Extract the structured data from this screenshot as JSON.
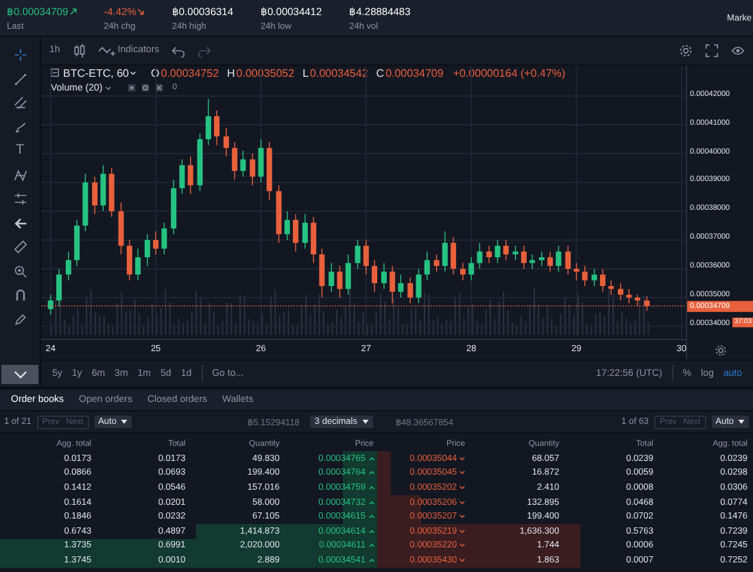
{
  "ticker": [
    {
      "value": "฿0.00034709",
      "label": "Last",
      "kind": "rise"
    },
    {
      "value": "-4.42%",
      "label": "24h chg",
      "kind": "fall"
    },
    {
      "value": "฿0.00036314",
      "label": "24h high",
      "kind": "plain"
    },
    {
      "value": "฿0.00034412",
      "label": "24h low",
      "kind": "plain"
    },
    {
      "value": "฿4.28884483",
      "label": "24h vol",
      "kind": "plain"
    }
  ],
  "market_tab": "Marke",
  "toolbar": {
    "interval": "1h",
    "indicators": "Indicators"
  },
  "text_tool": "T",
  "legend": {
    "symbol": "BTC-ETC, 60",
    "open_label": "O",
    "open": "0.00034752",
    "high_label": "H",
    "high": "0.00035052",
    "low_label": "L",
    "low": "0.00034542",
    "close_label": "C",
    "close": "0.00034709",
    "change": "+0.00000164 (+0.47%)"
  },
  "volume": {
    "label": "Volume (20)",
    "value": "0"
  },
  "chart_data": {
    "type": "candlestick",
    "x": [
      24,
      24.08,
      24.17,
      24.25,
      24.33,
      24.42,
      24.5,
      24.58,
      24.67,
      24.75,
      24.83,
      24.92,
      25,
      25.08,
      25.17,
      25.25,
      25.33,
      25.42,
      25.5,
      25.58,
      25.67,
      25.75,
      25.83,
      25.92,
      26,
      26.08,
      26.17,
      26.25,
      26.33,
      26.42,
      26.5,
      26.58,
      26.67,
      26.75,
      26.83,
      26.92,
      27,
      27.08,
      27.17,
      27.25,
      27.33,
      27.42,
      27.5,
      27.58,
      27.67,
      27.75,
      27.83,
      27.92,
      28,
      28.08,
      28.17,
      28.25,
      28.33,
      28.42,
      28.5,
      28.58,
      28.67,
      28.75,
      28.83,
      28.92,
      29,
      29.08,
      29.17,
      29.25,
      29.33,
      29.42,
      29.5,
      29.58,
      29.67
    ],
    "ohlc": [
      [
        0.000346,
        0.000351,
        0.000344,
        0.000349
      ],
      [
        0.000349,
        0.00036,
        0.000347,
        0.000358
      ],
      [
        0.000358,
        0.000366,
        0.000356,
        0.000363
      ],
      [
        0.000363,
        0.000377,
        0.000361,
        0.000375
      ],
      [
        0.000375,
        0.000393,
        0.000373,
        0.00039
      ],
      [
        0.00039,
        0.000392,
        0.000379,
        0.000382
      ],
      [
        0.000382,
        0.000396,
        0.00038,
        0.000393
      ],
      [
        0.000393,
        0.000395,
        0.000378,
        0.00038
      ],
      [
        0.00038,
        0.000383,
        0.000365,
        0.000368
      ],
      [
        0.000368,
        0.00037,
        0.000356,
        0.000358
      ],
      [
        0.000358,
        0.000367,
        0.000356,
        0.000364
      ],
      [
        0.000364,
        0.000372,
        0.000361,
        0.00037
      ],
      [
        0.00037,
        0.000373,
        0.000365,
        0.000367
      ],
      [
        0.000367,
        0.000376,
        0.000365,
        0.000374
      ],
      [
        0.000374,
        0.000391,
        0.000372,
        0.000388
      ],
      [
        0.000388,
        0.000398,
        0.000386,
        0.000396
      ],
      [
        0.000396,
        0.000399,
        0.000386,
        0.000389
      ],
      [
        0.000389,
        0.000407,
        0.000387,
        0.000405
      ],
      [
        0.000405,
        0.000419,
        0.000403,
        0.000413
      ],
      [
        0.000413,
        0.000415,
        0.000403,
        0.000406
      ],
      [
        0.000406,
        0.000409,
        0.000399,
        0.000402
      ],
      [
        0.000402,
        0.000404,
        0.000391,
        0.000394
      ],
      [
        0.000394,
        0.000401,
        0.000392,
        0.000398
      ],
      [
        0.000398,
        0.0004,
        0.000389,
        0.000392
      ],
      [
        0.000392,
        0.000405,
        0.00039,
        0.000402
      ],
      [
        0.000402,
        0.000404,
        0.000384,
        0.000387
      ],
      [
        0.000387,
        0.000389,
        0.000369,
        0.000372
      ],
      [
        0.000372,
        0.00038,
        0.00037,
        0.000377
      ],
      [
        0.000377,
        0.000379,
        0.000366,
        0.000369
      ],
      [
        0.000369,
        0.000379,
        0.000367,
        0.000376
      ],
      [
        0.000376,
        0.000378,
        0.000362,
        0.000365
      ],
      [
        0.000365,
        0.000367,
        0.00035,
        0.000354
      ],
      [
        0.000354,
        0.000362,
        0.000352,
        0.000359
      ],
      [
        0.000359,
        0.000361,
        0.00035,
        0.000353
      ],
      [
        0.000353,
        0.000365,
        0.000351,
        0.000362
      ],
      [
        0.000362,
        0.00037,
        0.00036,
        0.000368
      ],
      [
        0.000368,
        0.00037,
        0.000358,
        0.000361
      ],
      [
        0.000361,
        0.000363,
        0.000352,
        0.000355
      ],
      [
        0.000355,
        0.000362,
        0.000353,
        0.000359
      ],
      [
        0.000359,
        0.000361,
        0.000348,
        0.000352
      ],
      [
        0.000352,
        0.000358,
        0.00035,
        0.000355
      ],
      [
        0.000355,
        0.000357,
        0.000348,
        0.00035
      ],
      [
        0.00035,
        0.00036,
        0.000348,
        0.000358
      ],
      [
        0.000358,
        0.000366,
        0.000356,
        0.000363
      ],
      [
        0.000363,
        0.000365,
        0.000359,
        0.000361
      ],
      [
        0.000361,
        0.000373,
        0.000359,
        0.000369
      ],
      [
        0.000369,
        0.000371,
        0.000358,
        0.00036
      ],
      [
        0.00036,
        0.000362,
        0.000356,
        0.000358
      ],
      [
        0.000358,
        0.000364,
        0.000356,
        0.000362
      ],
      [
        0.000362,
        0.000369,
        0.00036,
        0.000366
      ],
      [
        0.000366,
        0.000368,
        0.000362,
        0.000364
      ],
      [
        0.000364,
        0.00037,
        0.000362,
        0.000368
      ],
      [
        0.000368,
        0.00037,
        0.000363,
        0.000365
      ],
      [
        0.000365,
        0.000368,
        0.000363,
        0.000366
      ],
      [
        0.000366,
        0.000368,
        0.00036,
        0.000362
      ],
      [
        0.000362,
        0.000365,
        0.00036,
        0.000363
      ],
      [
        0.000363,
        0.000366,
        0.000361,
        0.000364
      ],
      [
        0.000364,
        0.000366,
        0.000359,
        0.000361
      ],
      [
        0.000361,
        0.000368,
        0.000359,
        0.000366
      ],
      [
        0.000366,
        0.000368,
        0.000358,
        0.00036
      ],
      [
        0.00036,
        0.000362,
        0.000356,
        0.000359
      ],
      [
        0.000359,
        0.000361,
        0.000354,
        0.000356
      ],
      [
        0.000356,
        0.00036,
        0.000354,
        0.000358
      ],
      [
        0.000358,
        0.00036,
        0.000352,
        0.000354
      ],
      [
        0.000354,
        0.000356,
        0.000351,
        0.000353
      ],
      [
        0.000353,
        0.000355,
        0.000349,
        0.000351
      ],
      [
        0.000351,
        0.000353,
        0.000348,
        0.00035
      ],
      [
        0.00035,
        0.000351,
        0.000347,
        0.000349
      ],
      [
        0.000349,
        0.0003505,
        0.0003454,
        0.0003471
      ]
    ],
    "yticks": [
      {
        "value": 0.00042,
        "label": "0.00042000"
      },
      {
        "value": 0.00041,
        "label": "0.00041000"
      },
      {
        "value": 0.0004,
        "label": "0.00040000"
      },
      {
        "value": 0.00039,
        "label": "0.00039000"
      },
      {
        "value": 0.00038,
        "label": "0.00038000"
      },
      {
        "value": 0.00037,
        "label": "0.00037000"
      },
      {
        "value": 0.00036,
        "label": "0.00036000"
      },
      {
        "value": 0.00035,
        "label": "0.00035000"
      },
      {
        "value": 0.00034,
        "label": "0.00034000"
      }
    ],
    "xticks": [
      24,
      25,
      26,
      27,
      28,
      29,
      30
    ],
    "xlim": [
      23.91,
      30.04
    ],
    "ylim": [
      0.0003352,
      0.0004305
    ],
    "grid": true,
    "ref_lines": [
      {
        "axis": "y",
        "value": 0.00034709
      }
    ]
  },
  "last_price": "0.00034709",
  "countdown": "37:03",
  "ranges": [
    "5y",
    "1y",
    "6m",
    "3m",
    "1m",
    "5d",
    "1d"
  ],
  "goto": "Go to...",
  "clock": "17:22:56 (UTC)",
  "scale_options": [
    {
      "label": "%",
      "selected": false
    },
    {
      "label": "log",
      "selected": false
    },
    {
      "label": "auto",
      "selected": true
    }
  ],
  "tabs": [
    {
      "label": "Order books",
      "selected": true
    },
    {
      "label": "Open orders",
      "selected": false
    },
    {
      "label": "Closed orders",
      "selected": false
    },
    {
      "label": "Wallets",
      "selected": false
    }
  ],
  "center": {
    "bid_sum": "฿5.15294118",
    "decimals": "3 decimals",
    "ask_sum": "฿48.36567854"
  },
  "bids": {
    "page": "1 of 21",
    "prev": "Prev",
    "next": "Next",
    "grouping": "Auto",
    "columns": [
      "Agg. total",
      "Total",
      "Quantity",
      "Price"
    ],
    "rows": [
      {
        "agg": "0.0173",
        "total": "0.0173",
        "quantity": "49.830",
        "price": "0.00034765"
      },
      {
        "agg": "0.0866",
        "total": "0.0693",
        "quantity": "199.400",
        "price": "0.00034764"
      },
      {
        "agg": "0.1412",
        "total": "0.0546",
        "quantity": "157.016",
        "price": "0.00034759"
      },
      {
        "agg": "0.1614",
        "total": "0.0201",
        "quantity": "58.000",
        "price": "0.00034732"
      },
      {
        "agg": "0.1846",
        "total": "0.0232",
        "quantity": "67.105",
        "price": "0.00034615"
      },
      {
        "agg": "0.6743",
        "total": "0.4897",
        "quantity": "1,414.873",
        "price": "0.00034614"
      },
      {
        "agg": "1.3735",
        "total": "0.6991",
        "quantity": "2,020.000",
        "price": "0.00034611"
      },
      {
        "agg": "1.3745",
        "total": "0.0010",
        "quantity": "2.889",
        "price": "0.00034541"
      }
    ]
  },
  "asks": {
    "page": "1 of 63",
    "prev": "Prev",
    "next": "Next",
    "grouping": "Auto",
    "columns": [
      "Price",
      "Quantity",
      "Total",
      "Agg. total"
    ],
    "rows": [
      {
        "price": "0.00035044",
        "quantity": "68.057",
        "total": "0.0239",
        "agg": "0.0239"
      },
      {
        "price": "0.00035045",
        "quantity": "16.872",
        "total": "0.0059",
        "agg": "0.0298"
      },
      {
        "price": "0.00035202",
        "quantity": "2.410",
        "total": "0.0008",
        "agg": "0.0306"
      },
      {
        "price": "0.00035206",
        "quantity": "132.895",
        "total": "0.0468",
        "agg": "0.0774"
      },
      {
        "price": "0.00035207",
        "quantity": "199.400",
        "total": "0.0702",
        "agg": "0.1476"
      },
      {
        "price": "0.00035219",
        "quantity": "1,636.300",
        "total": "0.5763",
        "agg": "0.7239"
      },
      {
        "price": "0.00035220",
        "quantity": "1.744",
        "total": "0.0006",
        "agg": "0.7245"
      },
      {
        "price": "0.00035430",
        "quantity": "1.863",
        "total": "0.0007",
        "agg": "0.7252"
      }
    ]
  }
}
